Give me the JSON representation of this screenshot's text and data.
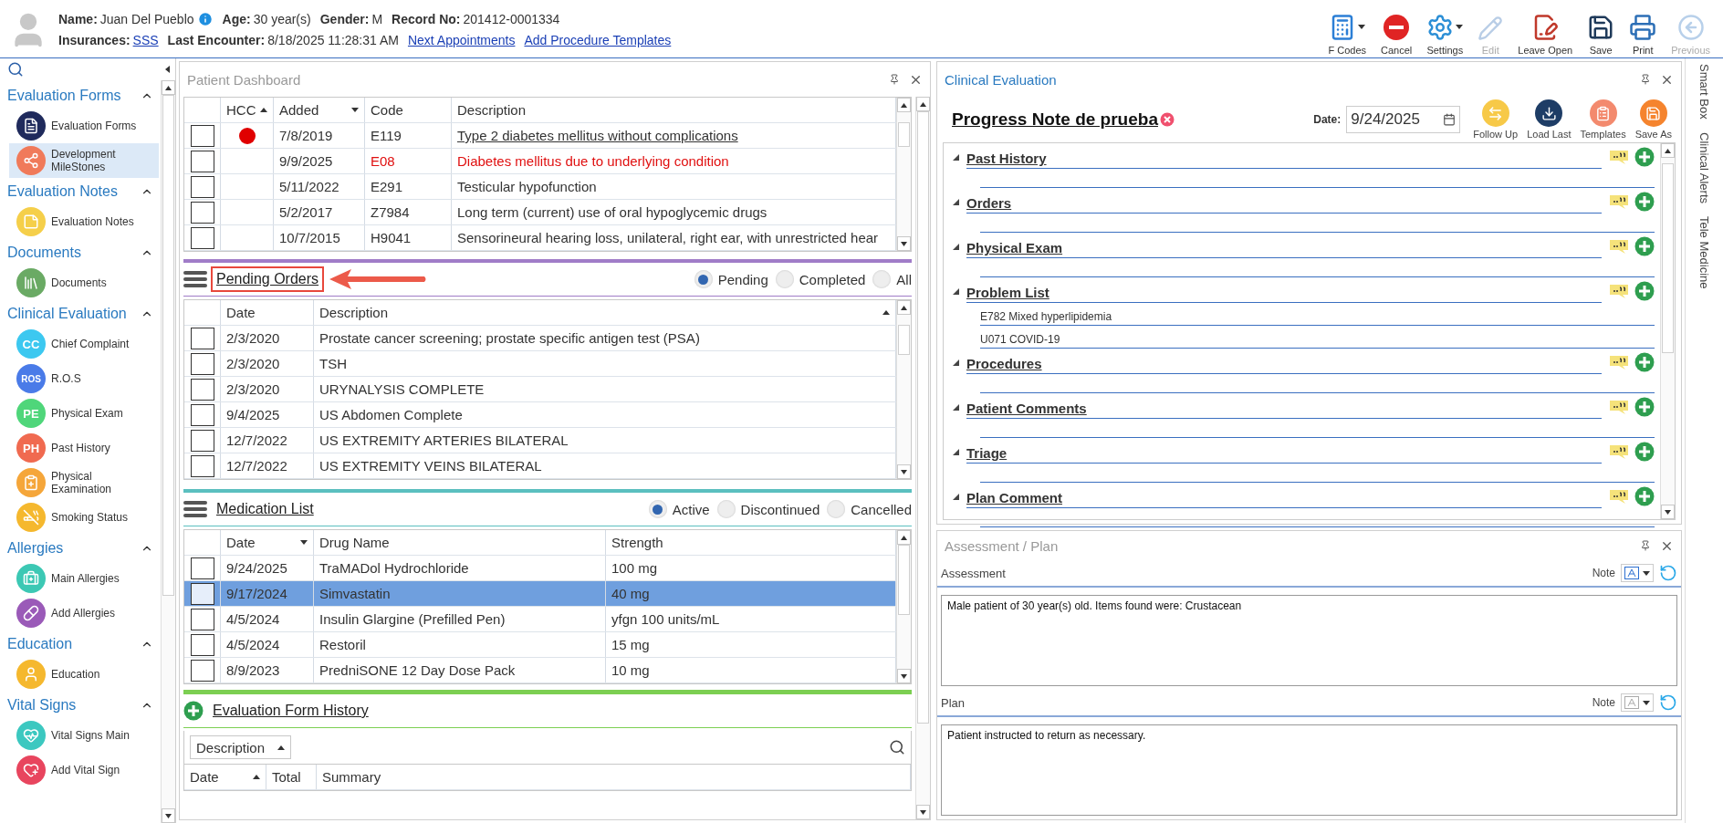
{
  "header": {
    "fields_top": [
      {
        "label": "Name:",
        "value": "Juan Del Pueblo",
        "kind": "info"
      },
      {
        "label": "Age:",
        "value": "30 year(s)",
        "kind": "text"
      },
      {
        "label": "Gender:",
        "value": "M",
        "kind": "text"
      },
      {
        "label": "Record No:",
        "value": "201412-0001334",
        "kind": "text"
      }
    ],
    "fields_bottom": [
      {
        "label": "Insurances:",
        "value": "SSS",
        "kind": "link"
      },
      {
        "label": "Last Encounter:",
        "value": "8/18/2025 11:28:31 AM",
        "kind": "text"
      },
      {
        "value": "Next Appointments",
        "kind": "link"
      },
      {
        "value": "Add Procedure Templates",
        "kind": "link"
      }
    ],
    "toolbar": [
      {
        "label": "F Codes",
        "kind": "calculator",
        "dropdown": true,
        "disabled": false
      },
      {
        "label": "Cancel",
        "kind": "cancel",
        "dropdown": false,
        "disabled": false
      },
      {
        "label": "Settings",
        "kind": "gears",
        "dropdown": true,
        "disabled": false
      },
      {
        "label": "Edit",
        "kind": "pencil",
        "dropdown": false,
        "disabled": true
      },
      {
        "label": "Leave Open",
        "kind": "leave-open",
        "dropdown": false,
        "disabled": false
      },
      {
        "label": "Save",
        "kind": "save",
        "dropdown": false,
        "disabled": false
      },
      {
        "label": "Print",
        "kind": "print",
        "dropdown": false,
        "disabled": false
      },
      {
        "label": "Previous",
        "kind": "previous",
        "dropdown": false,
        "disabled": true
      }
    ]
  },
  "sidebar": {
    "groups": [
      {
        "title": "Evaluation Forms",
        "expanded": true,
        "items": [
          {
            "label": "Evaluation Forms",
            "kind": "form",
            "color": "#1f2a5c",
            "selected": false
          },
          {
            "label": "Development MileStones",
            "kind": "milestones",
            "color": "#f07a5a",
            "selected": true
          }
        ]
      },
      {
        "title": "Evaluation Notes",
        "expanded": true,
        "items": [
          {
            "label": "Evaluation Notes",
            "kind": "note",
            "color": "#f5cf4a",
            "selected": false
          }
        ]
      },
      {
        "title": "Documents",
        "expanded": true,
        "items": [
          {
            "label": "Documents",
            "kind": "documents",
            "color": "#6aaa64",
            "selected": false
          }
        ]
      },
      {
        "title": "Clinical Evaluation",
        "expanded": true,
        "items": [
          {
            "label": "Chief Complaint",
            "kind": "letters",
            "badge": "CC",
            "color": "#3cc8f0",
            "selected": false
          },
          {
            "label": "R.O.S",
            "kind": "letters",
            "badge": "ROS",
            "color": "#4a7be8",
            "selected": false
          },
          {
            "label": "Physical Exam",
            "kind": "letters",
            "badge": "PE",
            "color": "#4fd67a",
            "selected": false
          },
          {
            "label": "Past History",
            "kind": "letters",
            "badge": "PH",
            "color": "#f06a50",
            "selected": false
          },
          {
            "label": "Physical Examination",
            "kind": "clipboard",
            "color": "#f5a63a",
            "selected": false
          },
          {
            "label": "Smoking Status",
            "kind": "smoking",
            "color": "#f5b82e",
            "selected": false
          }
        ]
      },
      {
        "title": "Allergies",
        "expanded": true,
        "items": [
          {
            "label": "Main Allergies",
            "kind": "bottle",
            "color": "#3cc8b4",
            "selected": false
          },
          {
            "label": "Add Allergies",
            "kind": "pills",
            "color": "#9a5ab8",
            "selected": false
          }
        ]
      },
      {
        "title": "Education",
        "expanded": true,
        "items": [
          {
            "label": "Education",
            "kind": "person",
            "color": "#f5b82e",
            "selected": false
          }
        ]
      },
      {
        "title": "Vital Signs",
        "expanded": true,
        "items": [
          {
            "label": "Vital Signs Main",
            "kind": "heart",
            "color": "#3cc8c0",
            "selected": false
          },
          {
            "label": "Add Vital Sign",
            "kind": "heart-plus",
            "color": "#e8455e",
            "selected": false
          }
        ]
      }
    ]
  },
  "dashboard": {
    "title": "Patient Dashboard",
    "problems": {
      "columns": [
        {
          "label": "HCC",
          "sort_up": true
        },
        {
          "label": "Added",
          "sort_up": false
        },
        {
          "label": "Code"
        },
        {
          "label": "Description"
        }
      ],
      "rows": [
        {
          "checked": false,
          "hcc": true,
          "added": "7/8/2019",
          "code": "E119",
          "description": "Type 2 diabetes mellitus without complications",
          "kind": "link"
        },
        {
          "checked": false,
          "hcc": false,
          "added": "9/9/2025",
          "code": "E08",
          "description": "Diabetes mellitus due to underlying condition",
          "kind": "alert"
        },
        {
          "checked": false,
          "hcc": false,
          "added": "5/11/2022",
          "code": "E291",
          "description": "Testicular hypofunction",
          "kind": "plain"
        },
        {
          "checked": false,
          "hcc": false,
          "added": "5/2/2017",
          "code": "Z7984",
          "description": "Long term (current) use of oral hypoglycemic drugs",
          "kind": "plain"
        },
        {
          "checked": false,
          "hcc": false,
          "added": "10/7/2015",
          "code": "H9041",
          "description": "Sensorineural hearing loss, unilateral, right ear, with unrestricted hear",
          "kind": "plain"
        }
      ]
    },
    "pending_orders": {
      "title": "Pending Orders",
      "highlighted": true,
      "color": "#a07cc8",
      "filters": [
        {
          "label": "Pending",
          "selected": true
        },
        {
          "label": "Completed",
          "selected": false
        },
        {
          "label": "All",
          "selected": false
        }
      ],
      "columns": [
        {
          "label": "Date"
        },
        {
          "label": "Description",
          "sort_up": true
        }
      ],
      "rows": [
        {
          "checked": false,
          "date": "2/3/2020",
          "description": "Prostate cancer screening; prostate specific antigen test (PSA)"
        },
        {
          "checked": false,
          "date": "2/3/2020",
          "description": "TSH"
        },
        {
          "checked": false,
          "date": "2/3/2020",
          "description": "URYNALYSIS COMPLETE"
        },
        {
          "checked": false,
          "date": "9/4/2025",
          "description": "US Abdomen Complete"
        },
        {
          "checked": false,
          "date": "12/7/2022",
          "description": "US EXTREMITY ARTERIES BILATERAL"
        },
        {
          "checked": false,
          "date": "12/7/2022",
          "description": "US EXTREMITY VEINS BILATERAL"
        }
      ]
    },
    "medication_list": {
      "title": "Medication List",
      "color": "#5bbfbf",
      "filters": [
        {
          "label": "Active",
          "selected": true
        },
        {
          "label": "Discontinued",
          "selected": false
        },
        {
          "label": "Cancelled",
          "selected": false
        }
      ],
      "columns": [
        {
          "label": "Date",
          "sort_up": false
        },
        {
          "label": "Drug Name"
        },
        {
          "label": "Strength"
        }
      ],
      "rows": [
        {
          "checked": false,
          "selected": false,
          "date": "9/24/2025",
          "drug": "TraMADol Hydrochloride",
          "strength": "100 mg"
        },
        {
          "checked": false,
          "selected": true,
          "date": "9/17/2024",
          "drug": "Simvastatin",
          "strength": "40 mg"
        },
        {
          "checked": false,
          "selected": false,
          "date": "4/5/2024",
          "drug": "Insulin Glargine (Prefilled Pen)",
          "strength": "yfgn 100 units/mL"
        },
        {
          "checked": false,
          "selected": false,
          "date": "4/5/2024",
          "drug": "Restoril",
          "strength": "15 mg"
        },
        {
          "checked": false,
          "selected": false,
          "date": "8/9/2023",
          "drug": "PredniSONE 12 Day Dose Pack",
          "strength": "10 mg"
        }
      ]
    },
    "form_history": {
      "title": "Evaluation Form History",
      "color": "#7ccf52",
      "filter": "Description",
      "columns": [
        {
          "label": "Date",
          "sort_up": true
        },
        {
          "label": "Total"
        },
        {
          "label": "Summary"
        }
      ]
    }
  },
  "clinical_evaluation": {
    "title": "Clinical Evaluation",
    "active": true,
    "note_title": "Progress Note de prueba",
    "date_label": "Date:",
    "date": "9/24/2025",
    "actions": [
      {
        "label": "Follow Up",
        "kind": "swap",
        "color": "#f7c948"
      },
      {
        "label": "Load Last",
        "kind": "load",
        "color": "#1e3d66"
      },
      {
        "label": "Templates",
        "kind": "templates",
        "color": "#f38a6e"
      },
      {
        "label": "Save As",
        "kind": "save",
        "color": "#f5842e"
      }
    ],
    "sections": [
      {
        "title": "Past History",
        "expanded": true
      },
      {
        "title": "Orders",
        "expanded": true
      },
      {
        "title": "Physical Exam",
        "expanded": true
      },
      {
        "title": "Problem List",
        "expanded": true,
        "entries": [
          "E782 Mixed hyperlipidemia",
          "U071 COVID-19"
        ]
      },
      {
        "title": "Procedures",
        "expanded": true
      },
      {
        "title": "Patient Comments",
        "expanded": true
      },
      {
        "title": "Triage",
        "expanded": true
      },
      {
        "title": "Plan Comment",
        "expanded": true
      }
    ]
  },
  "assessment_plan": {
    "title": "Assessment / Plan",
    "active": false,
    "fields": [
      {
        "label": "Assessment",
        "note_label": "Note",
        "note_enabled": true,
        "value": "Male patient of 30 year(s) old. Items found were:  Crustacean"
      },
      {
        "label": "Plan",
        "note_label": "Note",
        "note_enabled": false,
        "value": "Patient instructed to return as necessary."
      }
    ]
  },
  "side_tabs": [
    "Smart Box",
    "Clinical Alerts",
    "Tele Medicine"
  ]
}
